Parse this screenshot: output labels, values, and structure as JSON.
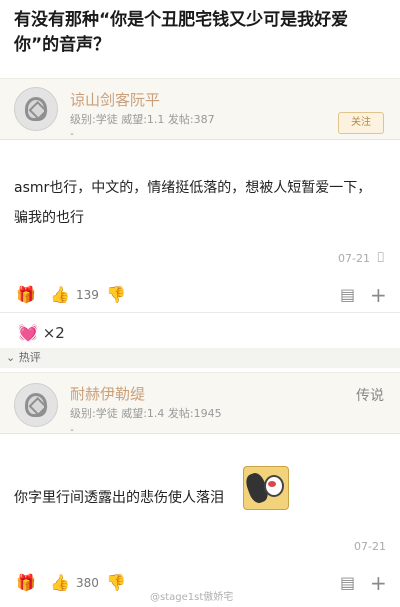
{
  "post_title": "有没有那种“你是个丑肥宅钱又少可是我好爱你”的音声？",
  "reply1": {
    "username": "谅山剑客阮平",
    "meta": "级别:学徒 威望:1.1 发帖:387",
    "dash": "-",
    "follow_label": "关注",
    "content": "asmr也行，中文的，情绪挺低落的，想被人短暂爱一下，骗我的也行",
    "date": "07-21",
    "likes": "139"
  },
  "reaction": {
    "heart": "💓",
    "count": "×2"
  },
  "hot_label": "热评",
  "reply2": {
    "username": "耐赫伊勒缇",
    "meta": "级别:学徒 威望:1.4 发帖:1945",
    "dash": "-",
    "action_label": "传说",
    "content": "你字里行间透露出的悲伤使人落泪",
    "date": "07-21",
    "likes": "380"
  },
  "watermark": "@stage1st傲娇宅",
  "icons": {
    "gift": "gift-icon",
    "like": "thumbs-up-icon",
    "dislike": "thumbs-down-icon",
    "comment": "comment-icon",
    "plus": "plus-icon",
    "apple": "apple-icon",
    "collapse": "chevron-down-icon"
  },
  "colors": {
    "username": "#c9a07b",
    "follow_border": "#e0c48c",
    "heart": "#d0476b"
  }
}
